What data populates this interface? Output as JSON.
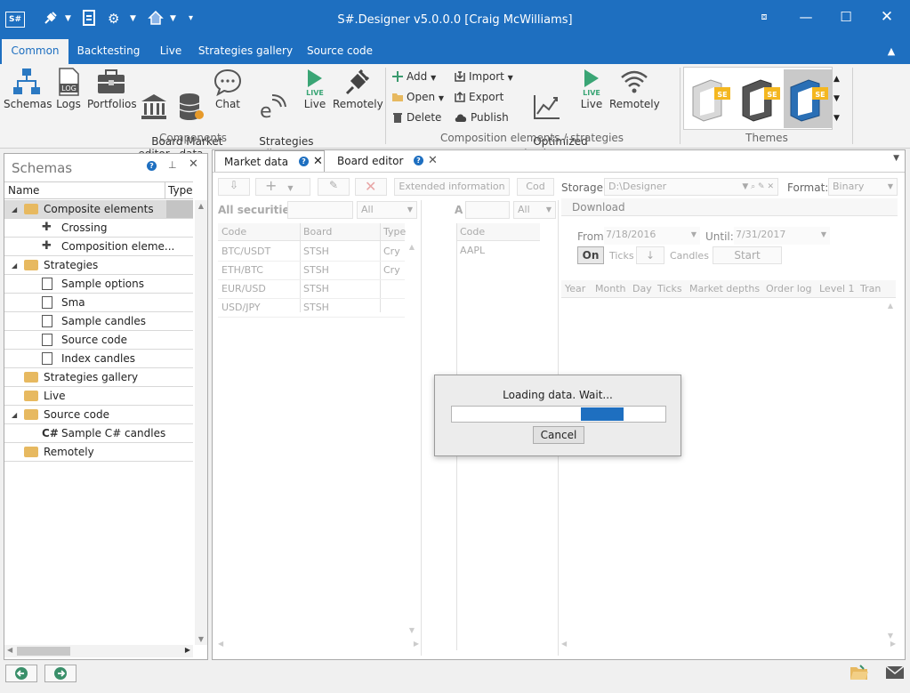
{
  "window": {
    "title": "S#.Designer v5.0.0.0 [Craig McWilliams]",
    "app_icon": "S#",
    "icons": [
      "plug-icon",
      "doc-icon",
      "gear-icon",
      "home-icon",
      "customize-icon"
    ]
  },
  "tabs": [
    "Common",
    "Backtesting",
    "Live",
    "Strategies gallery",
    "Source code"
  ],
  "ribbon": {
    "components": [
      {
        "label": "Schemas",
        "icon": "schemas-icon"
      },
      {
        "label": "Logs",
        "icon": "logs-icon"
      },
      {
        "label": "Portfolios",
        "icon": "briefcase-icon"
      },
      {
        "label": "Board\neditor",
        "icon": "board-icon"
      },
      {
        "label": "Market\ndata",
        "icon": "database-icon"
      },
      {
        "label": "Chat",
        "icon": "chat-icon"
      },
      {
        "label": "Strategies\ngallery",
        "icon": "gallery-icon"
      },
      {
        "label": "Live",
        "icon": "live-icon"
      },
      {
        "label": "Remotely",
        "icon": "plug-icon"
      }
    ],
    "components_group": "Components",
    "composition": {
      "add": "Add",
      "open": "Open",
      "delete": "Delete",
      "import": "Import",
      "export": "Export",
      "publish": "Publish",
      "optimized": "Optimized\nbacktest",
      "live": "Live",
      "remotely": "Remotely",
      "group": "Composition elements / strategies"
    },
    "themes_group": "Themes",
    "live_badge": "LIVE",
    "logs_badge": "LOG",
    "theme_badge": "SE"
  },
  "schemas": {
    "title": "Schemas",
    "col_name": "Name",
    "col_type": "Type",
    "items": [
      {
        "label": "Composite elements",
        "kind": "folder",
        "level": 0,
        "expanded": true,
        "selected": true
      },
      {
        "label": "Crossing",
        "kind": "puzzle",
        "level": 1
      },
      {
        "label": "Composition eleme...",
        "kind": "puzzle",
        "level": 1
      },
      {
        "label": "Strategies",
        "kind": "folder",
        "level": 0,
        "expanded": true
      },
      {
        "label": "Sample options",
        "kind": "doc",
        "level": 1
      },
      {
        "label": "Sma",
        "kind": "doc",
        "level": 1
      },
      {
        "label": "Sample candles",
        "kind": "doc",
        "level": 1
      },
      {
        "label": "Source code",
        "kind": "doc",
        "level": 1
      },
      {
        "label": "Index candles",
        "kind": "doc",
        "level": 1
      },
      {
        "label": "Strategies gallery",
        "kind": "folder",
        "level": 0
      },
      {
        "label": "Live",
        "kind": "folder",
        "level": 0
      },
      {
        "label": "Source code",
        "kind": "folder",
        "level": 0,
        "expanded": true
      },
      {
        "label": "Sample C# candles",
        "kind": "csharp",
        "level": 1
      },
      {
        "label": "Remotely",
        "kind": "folder",
        "level": 0
      }
    ]
  },
  "doc_tabs": [
    {
      "label": "Market data",
      "active": true
    },
    {
      "label": "Board editor",
      "active": false
    }
  ],
  "market": {
    "toolbar": {
      "extended": "Extended information",
      "code": "Cod"
    },
    "all_securities": "All securities",
    "all": "All",
    "a_label": "A",
    "all2": "All",
    "cols": [
      "Code",
      "Board",
      "Type"
    ],
    "rows": [
      [
        "BTC/USDT",
        "STSH",
        "Cry"
      ],
      [
        "ETH/BTC",
        "STSH",
        "Cry"
      ],
      [
        "EUR/USD",
        "STSH",
        ""
      ],
      [
        "USD/JPY",
        "STSH",
        ""
      ]
    ],
    "right_cols": [
      "Code"
    ],
    "right_rows": [
      "AAPL"
    ],
    "storage_label": "Storage:",
    "storage_value": "D:\\Designer",
    "format_label": "Format:",
    "format_value": "Binary",
    "download": "Download",
    "from_label": "From:",
    "from_value": "7/18/2016",
    "until_label": "Until:",
    "until_value": "7/31/2017",
    "on_btn": "On",
    "ticks": "Ticks",
    "candles": "Candles",
    "start": "Start",
    "down_arrow": "↓",
    "stat_cols": [
      "Year",
      "Month",
      "Day",
      "Ticks",
      "Market depths",
      "Order log",
      "Level 1",
      "Tran"
    ]
  },
  "dialog": {
    "message": "Loading data. Wait...",
    "cancel": "Cancel",
    "progress_start": 0.605,
    "progress_end": 0.805
  }
}
